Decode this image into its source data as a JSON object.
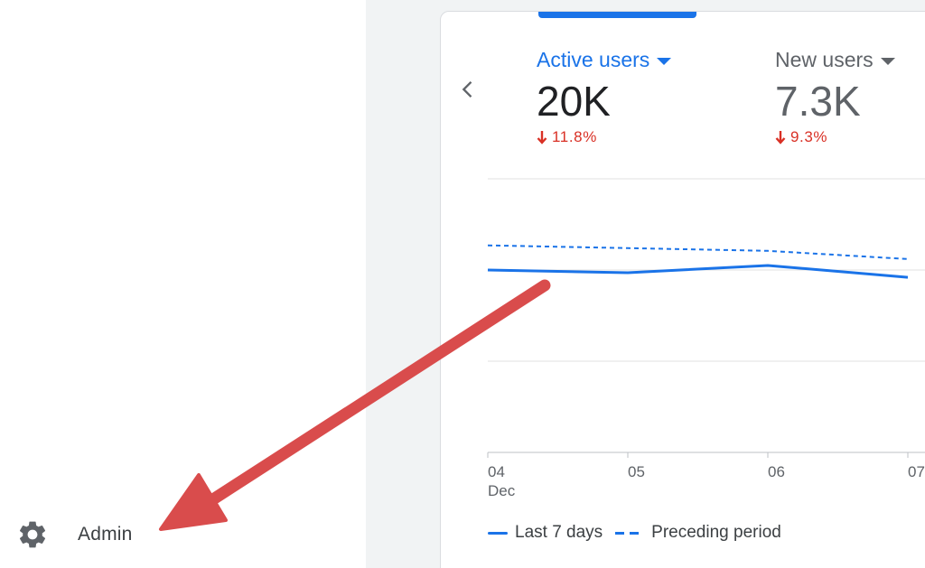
{
  "sidebar": {
    "admin": {
      "label": "Admin",
      "icon": "gear-icon"
    }
  },
  "card": {
    "prev_icon": "chevron-left-icon",
    "metrics": [
      {
        "title": "Active users",
        "value": "20K",
        "change": "11.8%",
        "direction": "down",
        "selected": true
      },
      {
        "title": "New users",
        "value": "7.3K",
        "change": "9.3%",
        "direction": "down",
        "selected": false
      }
    ],
    "legend": {
      "current": "Last 7 days",
      "previous": "Preceding period"
    }
  },
  "chart_data": {
    "type": "line",
    "x": [
      "04",
      "05",
      "06",
      "07"
    ],
    "x_sublabels": [
      "Dec",
      "",
      "",
      ""
    ],
    "series": [
      {
        "name": "Last 7 days",
        "style": "solid",
        "values": [
          20000,
          19700,
          20500,
          19200
        ]
      },
      {
        "name": "Preceding period",
        "style": "dashed",
        "values": [
          22700,
          22400,
          22100,
          21200
        ]
      }
    ],
    "ylim": [
      0,
      30000
    ],
    "grid": true
  },
  "colors": {
    "accent": "#1a73e8",
    "negative": "#d93025",
    "annotation_arrow": "#d94c4c"
  }
}
